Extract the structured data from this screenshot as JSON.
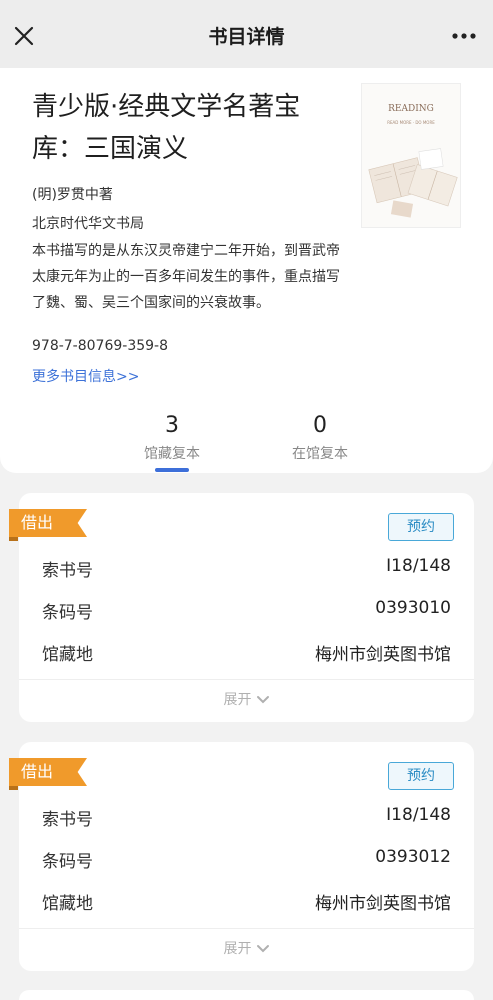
{
  "header": {
    "title": "书目详情"
  },
  "book": {
    "title": "青少版·经典文学名著宝库：三国演义",
    "author": "(明)罗贯中著",
    "publisher": "北京时代华文书局",
    "description": "本书描写的是从东汉灵帝建宁二年开始，到晋武帝太康元年为止的一百多年间发生的事件，重点描写了魏、蜀、吴三个国家间的兴衰故事。",
    "isbn": "978-7-80769-359-8",
    "more_link": "更多书目信息>>",
    "cover": {
      "heading": "READING",
      "subheading": "READ MORE · DO MORE"
    }
  },
  "stats": {
    "collection": {
      "value": "3",
      "label": "馆藏复本"
    },
    "available": {
      "value": "0",
      "label": "在馆复本"
    }
  },
  "copies": [
    {
      "status": "借出",
      "reserve_label": "预约",
      "call_no_label": "索书号",
      "call_no": "I18/148",
      "barcode_label": "条码号",
      "barcode": "0393010",
      "location_label": "馆藏地",
      "location": "梅州市剑英图书馆",
      "expand_label": "展开"
    },
    {
      "status": "借出",
      "reserve_label": "预约",
      "call_no_label": "索书号",
      "call_no": "I18/148",
      "barcode_label": "条码号",
      "barcode": "0393012",
      "location_label": "馆藏地",
      "location": "梅州市剑英图书馆",
      "expand_label": "展开"
    }
  ],
  "colors": {
    "accent": "#3d6fd9",
    "tag": "#f09a2b",
    "reserve": "#2b8cc4"
  }
}
